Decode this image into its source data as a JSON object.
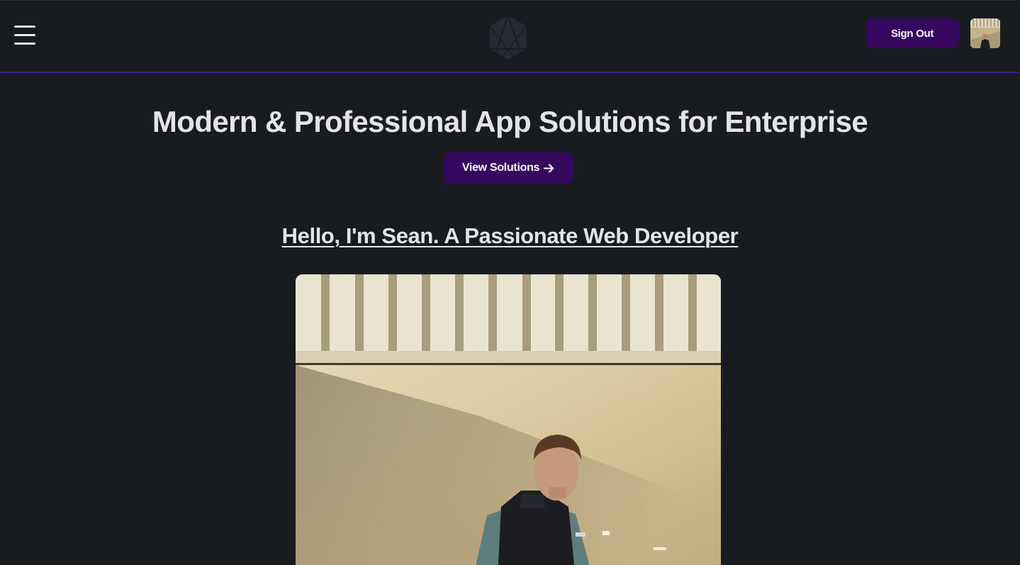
{
  "header": {
    "menu_icon": "hamburger-menu-icon",
    "logo_icon": "hexagon-logo-icon",
    "sign_out_label": "Sign Out",
    "avatar_icon": "user-avatar"
  },
  "hero": {
    "title": "Modern & Professional App Solutions for Enterprise",
    "cta_label": "View Solutions",
    "cta_icon": "arrow-right-icon"
  },
  "intro": {
    "heading": "Hello, I'm Sean. A Passionate Web Developer",
    "photo": "portrait-photo"
  },
  "colors": {
    "background": "#181c20",
    "accent": "#35075f",
    "header_border": "#3a1e8a",
    "text": "#e3e5e8"
  }
}
